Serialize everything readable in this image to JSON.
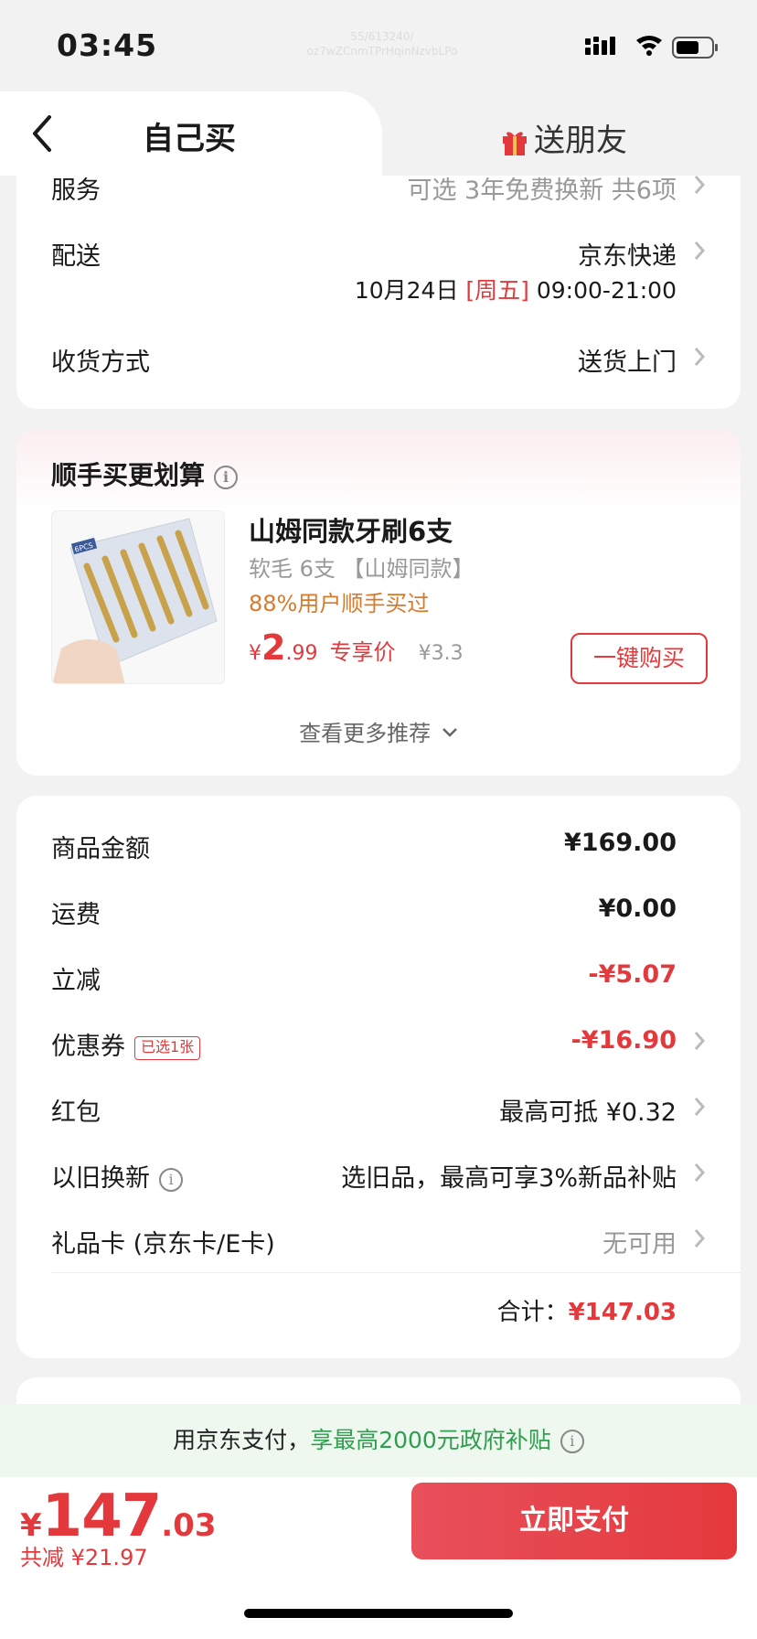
{
  "status": {
    "time": "03:45",
    "watermark": "55/613240/ oz7wZCnmTPrHqinNzvbLPo"
  },
  "tabs": {
    "self_label": "自己买",
    "friend_label": "送朋友"
  },
  "delivery": {
    "service_label": "服务",
    "service_value": "可选 3年免费换新 共6项",
    "shipping_label": "配送",
    "shipping_value": "京东快递",
    "date_prefix": "10月24日",
    "date_weekday": "[周五]",
    "date_time": "09:00-21:00",
    "receive_label": "收货方式",
    "receive_value": "送货上门"
  },
  "addon": {
    "title": "顺手买更划算",
    "product_name": "山姆同款牙刷6支",
    "product_spec": "软毛 6支 【山姆同款】",
    "product_popularity": "88%用户顺手买过",
    "price_currency": "¥",
    "price_int": "2",
    "price_dec": ".99",
    "price_tag": "专享价",
    "price_original": "¥3.3",
    "buy_button": "一键购买",
    "more": "查看更多推荐",
    "image_text": "6PCS"
  },
  "summary": {
    "goods_label": "商品金额",
    "goods_value": "¥169.00",
    "freight_label": "运费",
    "freight_value": "¥0.00",
    "discount_label": "立减",
    "discount_value": "-¥5.07",
    "coupon_label": "优惠券",
    "coupon_tag": "已选1张",
    "coupon_value": "-¥16.90",
    "redpacket_label": "红包",
    "redpacket_value": "最高可抵 ¥0.32",
    "tradein_label": "以旧换新",
    "tradein_value": "选旧品，最高可享3%新品补贴",
    "giftcard_label": "礼品卡 (京东卡/E卡)",
    "giftcard_value": "无可用",
    "total_label": "合计：",
    "total_value": "¥147.03"
  },
  "paybar": {
    "prefix": "用京东支付，",
    "highlight": "享最高2000元政府补贴"
  },
  "bottom": {
    "currency": "¥",
    "amount_int": "147",
    "amount_dec": ".03",
    "saving": "共减 ¥21.97",
    "pay_button": "立即支付"
  },
  "colors": {
    "accent": "#e4393c",
    "green": "#2f9e4f",
    "orange": "#d97a2b"
  },
  "icons": [
    "back-icon",
    "gift-icon",
    "chevron-right-icon",
    "info-icon",
    "chevron-down-icon",
    "signal-icon",
    "wifi-icon",
    "battery-icon"
  ]
}
